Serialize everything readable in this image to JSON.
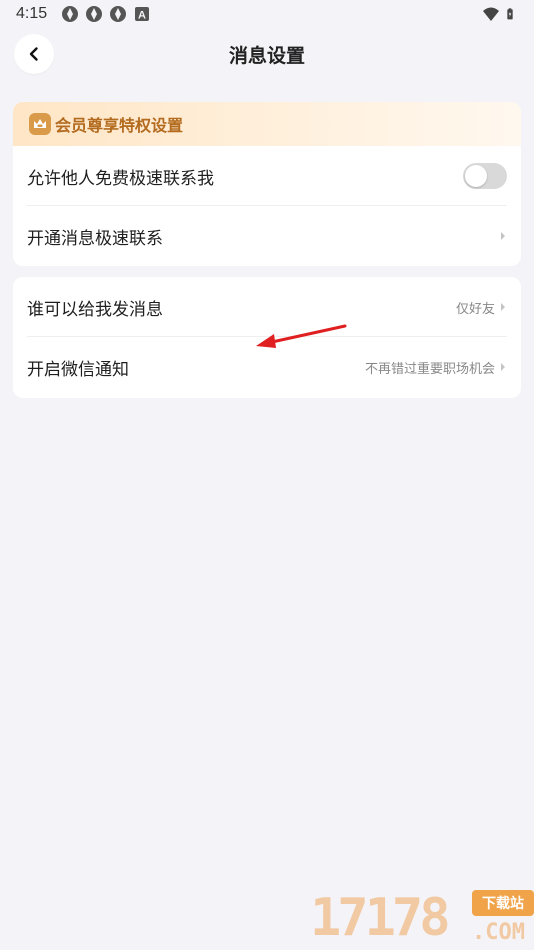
{
  "status_bar": {
    "time": "4:15",
    "left_icons": [
      "app-icon-1",
      "app-icon-2",
      "app-icon-3",
      "a-badge-icon"
    ],
    "right_icons": [
      "wifi-icon",
      "battery-icon"
    ]
  },
  "nav": {
    "title": "消息设置",
    "back_icon": "chevron-left-icon"
  },
  "vip": {
    "label": "会员尊享特权设置",
    "accent": "#b36b1f"
  },
  "card1": {
    "rows": [
      {
        "label": "允许他人免费极速联系我",
        "control": "toggle",
        "toggle_on": false
      },
      {
        "label": "开通消息极速联系",
        "control": "chevron"
      }
    ]
  },
  "card2": {
    "rows": [
      {
        "label": "谁可以给我发消息",
        "value": "仅好友"
      },
      {
        "label": "开启微信通知",
        "value": "不再错过重要职场机会"
      }
    ]
  },
  "annotation": {
    "color": "#e02020"
  },
  "watermark": {
    "number": "17178",
    "tag": "下载站",
    "suffix": ".COM"
  }
}
